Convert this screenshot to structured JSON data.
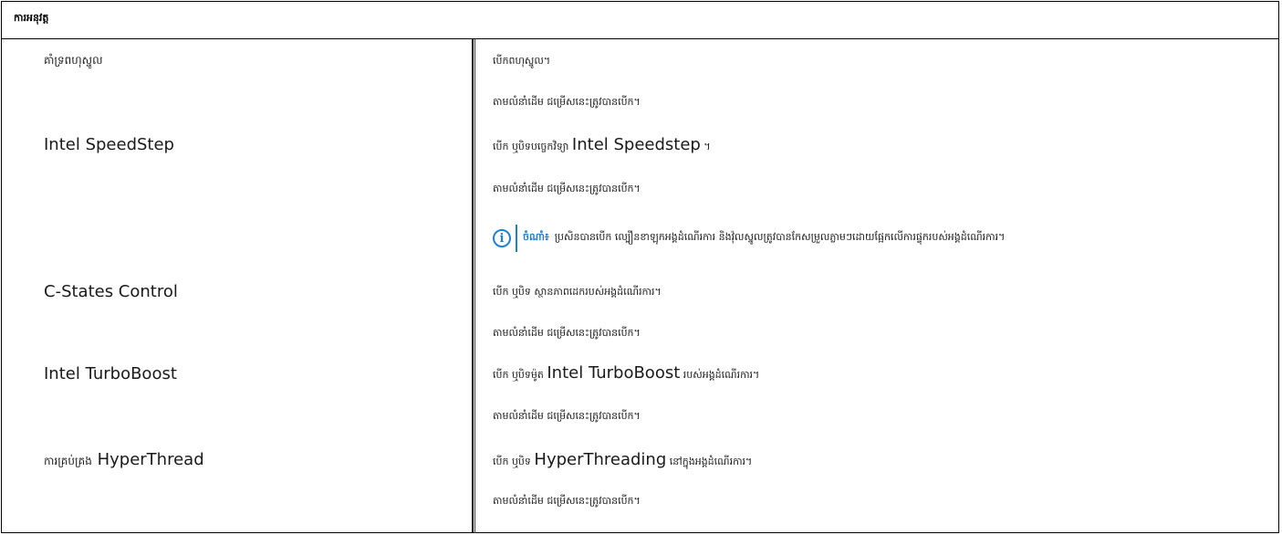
{
  "header": {
    "title": "ការអនុវត្ត"
  },
  "rows": [
    {
      "setting": "គាំទ្រពហុស្នូល",
      "description": "បើកពហុស្នូល។",
      "default": "តាមលំនាំដើម ជម្រើសនេះត្រូវបានបើក។"
    },
    {
      "setting": "Intel SpeedStep",
      "description_pre": "បើក ឬបិទបច្ចេកវិទ្យា",
      "description_product": "Intel Speedstep",
      "description_post": " ។",
      "default": "តាមលំនាំដើម ជម្រើសនេះត្រូវបានបើក។",
      "note": {
        "label": "ចំណាំ៖",
        "text": "ប្រសិនបានបើក ល្បឿនខាឡុកអង្គដំណើរការ និងវ៉ុលស្នូលត្រូវបានកែសម្រួលភ្លាមៗដោយផ្អែកលើការផ្ទុករបស់អង្គដំណើរការ។",
        "icon": "info-icon",
        "accent_color": "#1f7fd1"
      }
    },
    {
      "setting": "C-States Control",
      "description": "បើក ឬបិទ ស្ថានភាពដេករបស់អង្គដំណើរការ។",
      "default": "តាមលំនាំដើម ជម្រើសនេះត្រូវបានបើក។"
    },
    {
      "setting": "Intel TurboBoost",
      "description_pre": "បើក ឬបិទម៉ូត",
      "description_product": "Intel TurboBoost",
      "description_post": "របស់អង្គដំណើរការ។",
      "default": "តាមលំនាំដើម ជម្រើសនេះត្រូវបានបើក។"
    },
    {
      "setting_pre": "ការគ្រប់គ្រង",
      "setting_product": "HyperThread",
      "description_pre": "បើក ឬបិទ",
      "description_product": "HyperThreading",
      "description_post": "នៅក្នុងអង្គដំណើរការ។",
      "default": "តាមលំនាំដើម ជម្រើសនេះត្រូវបានបើក។"
    }
  ]
}
